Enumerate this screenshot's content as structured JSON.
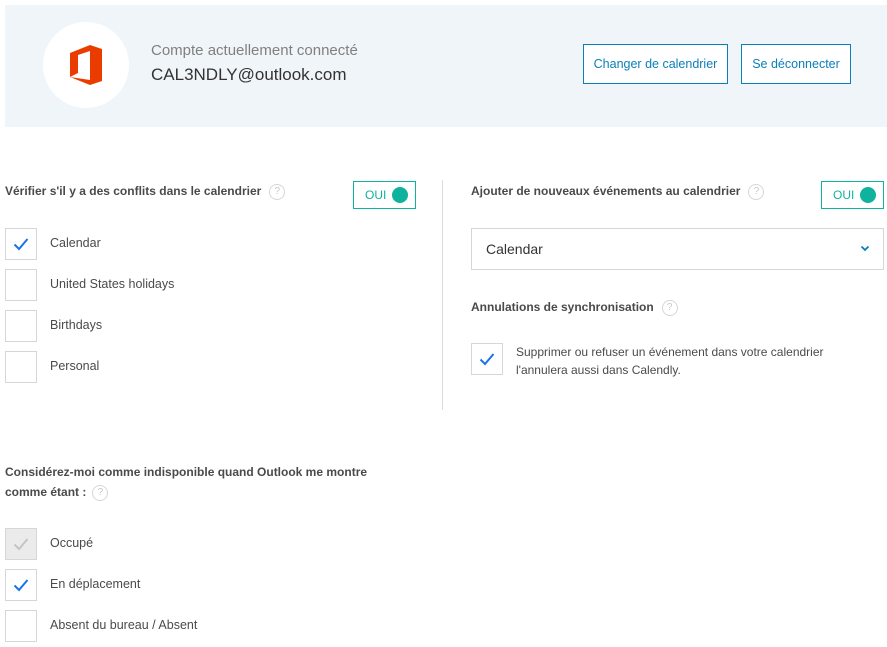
{
  "account": {
    "label": "Compte actuellement connecté",
    "email": "CAL3NDLY@outlook.com",
    "logo_icon": "office-logo-icon",
    "brand_color": "#eb3c00"
  },
  "buttons": {
    "change_calendar": "Changer de calendrier",
    "logout": "Se déconnecter"
  },
  "conflicts": {
    "title": "Vérifier s'il y a des conflits dans le calendrier",
    "toggle_label": "OUI",
    "items": [
      {
        "label": "Calendar",
        "checked": true
      },
      {
        "label": "United States holidays",
        "checked": false
      },
      {
        "label": "Birthdays",
        "checked": false
      },
      {
        "label": "Personal",
        "checked": false
      }
    ]
  },
  "add_events": {
    "title": "Ajouter de nouveaux événements au calendrier",
    "toggle_label": "OUI",
    "selected_calendar": "Calendar"
  },
  "sync": {
    "title": "Annulations de synchronisation",
    "checked": true,
    "text": "Supprimer ou refuser un événement dans votre calendrier l'annulera aussi dans Calendly."
  },
  "unavailable": {
    "title_line1": "Considérez-moi comme indisponible quand Outlook me montre",
    "title_line2": "comme étant :",
    "items": [
      {
        "label": "Occupé",
        "checked": true,
        "disabled": true
      },
      {
        "label": "En déplacement",
        "checked": true,
        "disabled": false
      },
      {
        "label": "Absent du bureau / Absent",
        "checked": false,
        "disabled": false
      }
    ]
  },
  "help_symbol": "?",
  "colors": {
    "accent": "#0a7fb8",
    "toggle_on": "#0fb39d",
    "check_blue": "#1a73e8",
    "check_disabled": "#c4c4c4"
  }
}
